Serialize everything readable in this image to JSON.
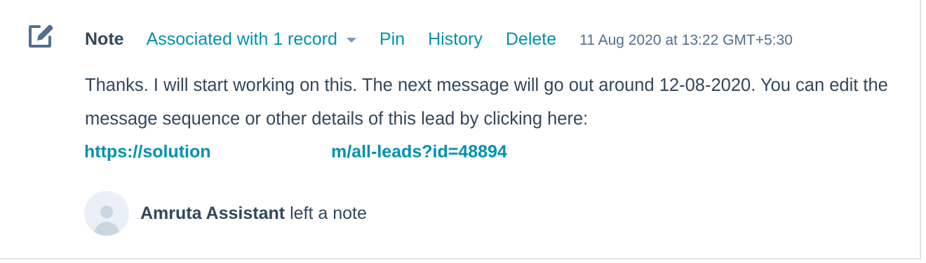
{
  "note": {
    "type_label": "Note",
    "association_label": "Associated with 1 record",
    "actions": {
      "pin": "Pin",
      "history": "History",
      "delete": "Delete"
    },
    "timestamp": "11 Aug 2020 at 13:22 GMT+5:30",
    "body": "Thanks. I will start working on this. The next message will go out around 12-08-2020. You can edit the message sequence or other details of this lead by clicking here:",
    "link": {
      "part1": "https://solution",
      "part2": "m/all-leads?id=48894"
    },
    "author": {
      "name": "Amruta Assistant",
      "action": "left a note"
    }
  },
  "icons": {
    "note": "edit-note-icon",
    "caret": "caret-down-icon",
    "avatar": "default-avatar-icon"
  },
  "colors": {
    "link": "#0091ae",
    "text": "#33475b",
    "icon": "#516f90",
    "muted": "#516f90",
    "avatar_bg": "#eaf0f6",
    "avatar_fg": "#cbd6e2"
  }
}
